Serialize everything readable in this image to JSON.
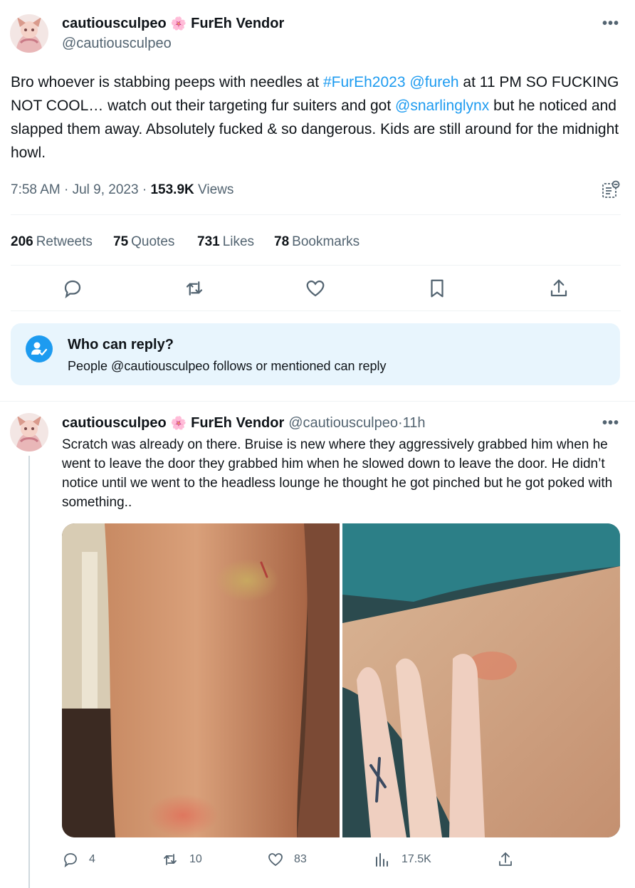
{
  "tweet": {
    "display_name": "cautiousculpeo",
    "flower_emoji": "🌸",
    "vendor_label": "FurEh Vendor",
    "handle": "@cautiousculpeo",
    "more": "•••",
    "text": {
      "p1": "Bro whoever is stabbing peeps with needles at ",
      "hashtag": "#FurEh2023",
      "p2": " ",
      "mention1": "@fureh",
      "p3": " at 11 PM SO FUCKING NOT COOL… watch out their targeting fur suiters and got ",
      "mention2": "@snarlinglynx",
      "p4": " but he noticed and slapped them away. Absolutely fucked & so dangerous. Kids are still around for the midnight howl."
    },
    "time": "7:58 AM",
    "sep1": " · ",
    "date": "Jul 9, 2023",
    "sep2": " · ",
    "views_count": "153.9K",
    "views_label": "Views",
    "stats": {
      "retweets_count": "206",
      "retweets_label": "Retweets",
      "quotes_count": "75",
      "quotes_label": "Quotes",
      "likes_count": "731",
      "likes_label": "Likes",
      "bookmarks_count": "78",
      "bookmarks_label": "Bookmarks"
    }
  },
  "who_can_reply": {
    "title": "Who can reply?",
    "subtitle": "People @cautiousculpeo follows or mentioned can reply"
  },
  "reply": {
    "display_name": "cautiousculpeo",
    "flower_emoji": "🌸",
    "vendor_label": "FurEh Vendor",
    "handle": "@cautiousculpeo",
    "sep": " · ",
    "time_ago": "11h",
    "more": "•••",
    "text": "Scratch was already on there. Bruise is new where they aggressively grabbed him when he went to leave the door they grabbed him when he slowed down to leave the door. He didn’t notice until we went to the headless lounge he thought he got pinched but he got poked with something..",
    "replies": "4",
    "retweets": "10",
    "likes": "83",
    "views": "17.5K"
  },
  "colors": {
    "accent": "#1d9bf0",
    "text": "#0f1419",
    "secondary": "#536471",
    "info_bg": "#e8f5fd"
  }
}
